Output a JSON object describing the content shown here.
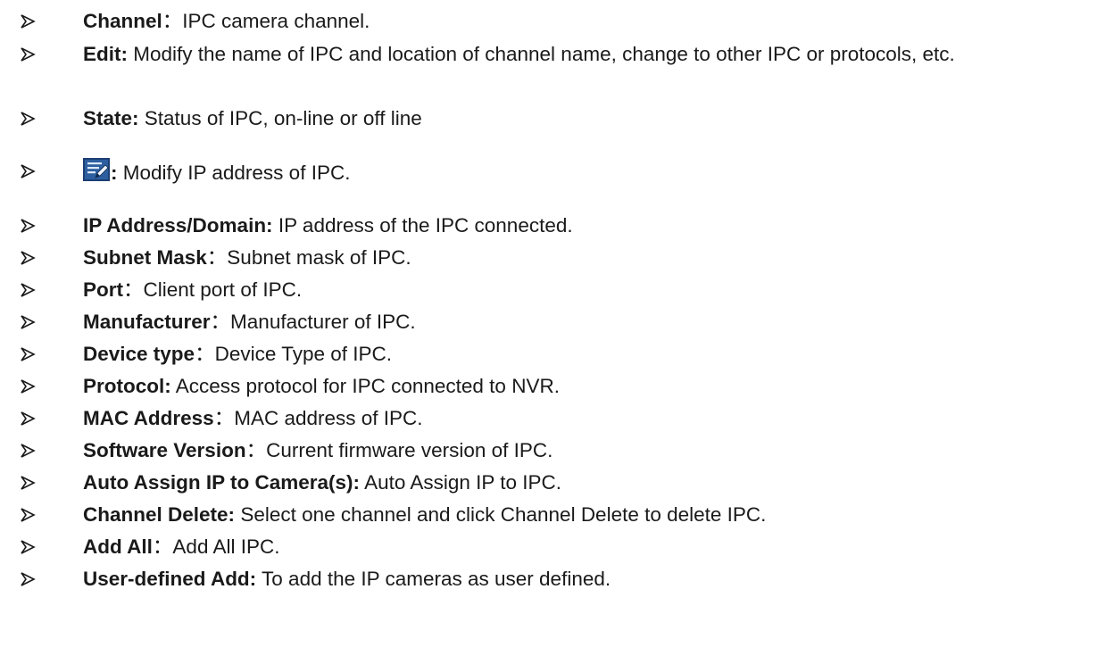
{
  "bullet_icon": "arrowhead-bullet-icon",
  "items": [
    {
      "term": "Channel",
      "sep": "：",
      "desc": "IPC camera channel."
    },
    {
      "term": "Edit:",
      "sep": " ",
      "desc": "Modify the name of IPC and location of channel name, change to other IPC or protocols, etc."
    },
    {
      "term": "State:",
      "sep": " ",
      "desc": "Status of IPC, on-line or off line"
    },
    {
      "icon": "edit-icon",
      "term": ":",
      "sep": " ",
      "desc": "Modify IP address of IPC."
    },
    {
      "term": "IP Address/Domain:",
      "sep": " ",
      "desc": "IP address of the IPC connected."
    },
    {
      "term": "Subnet Mask",
      "sep": "：",
      "desc": "Subnet mask of IPC."
    },
    {
      "term": "Port",
      "sep": "：",
      "desc": "Client port of IPC."
    },
    {
      "term": "Manufacturer",
      "sep": "：",
      "desc": "Manufacturer of IPC."
    },
    {
      "term": "Device type",
      "sep": "：",
      "desc": "Device Type of IPC."
    },
    {
      "term": "Protocol:",
      "sep": " ",
      "desc": "Access protocol for IPC connected to NVR."
    },
    {
      "term": "MAC Address",
      "sep": "：",
      "desc": "MAC address of IPC."
    },
    {
      "term": "Software Version",
      "sep": "：",
      "desc": "Current firmware version of IPC."
    },
    {
      "term": "Auto Assign IP to Camera(s):",
      "sep": " ",
      "desc": "Auto Assign IP to IPC."
    },
    {
      "term": "Channel Delete:",
      "sep": " ",
      "desc": "Select one channel and click Channel Delete to delete IPC."
    },
    {
      "term": "Add All",
      "sep": "：",
      "desc": "Add All IPC."
    },
    {
      "term": "User-defined Add:",
      "sep": " ",
      "desc": "To add the IP cameras as user defined."
    }
  ]
}
